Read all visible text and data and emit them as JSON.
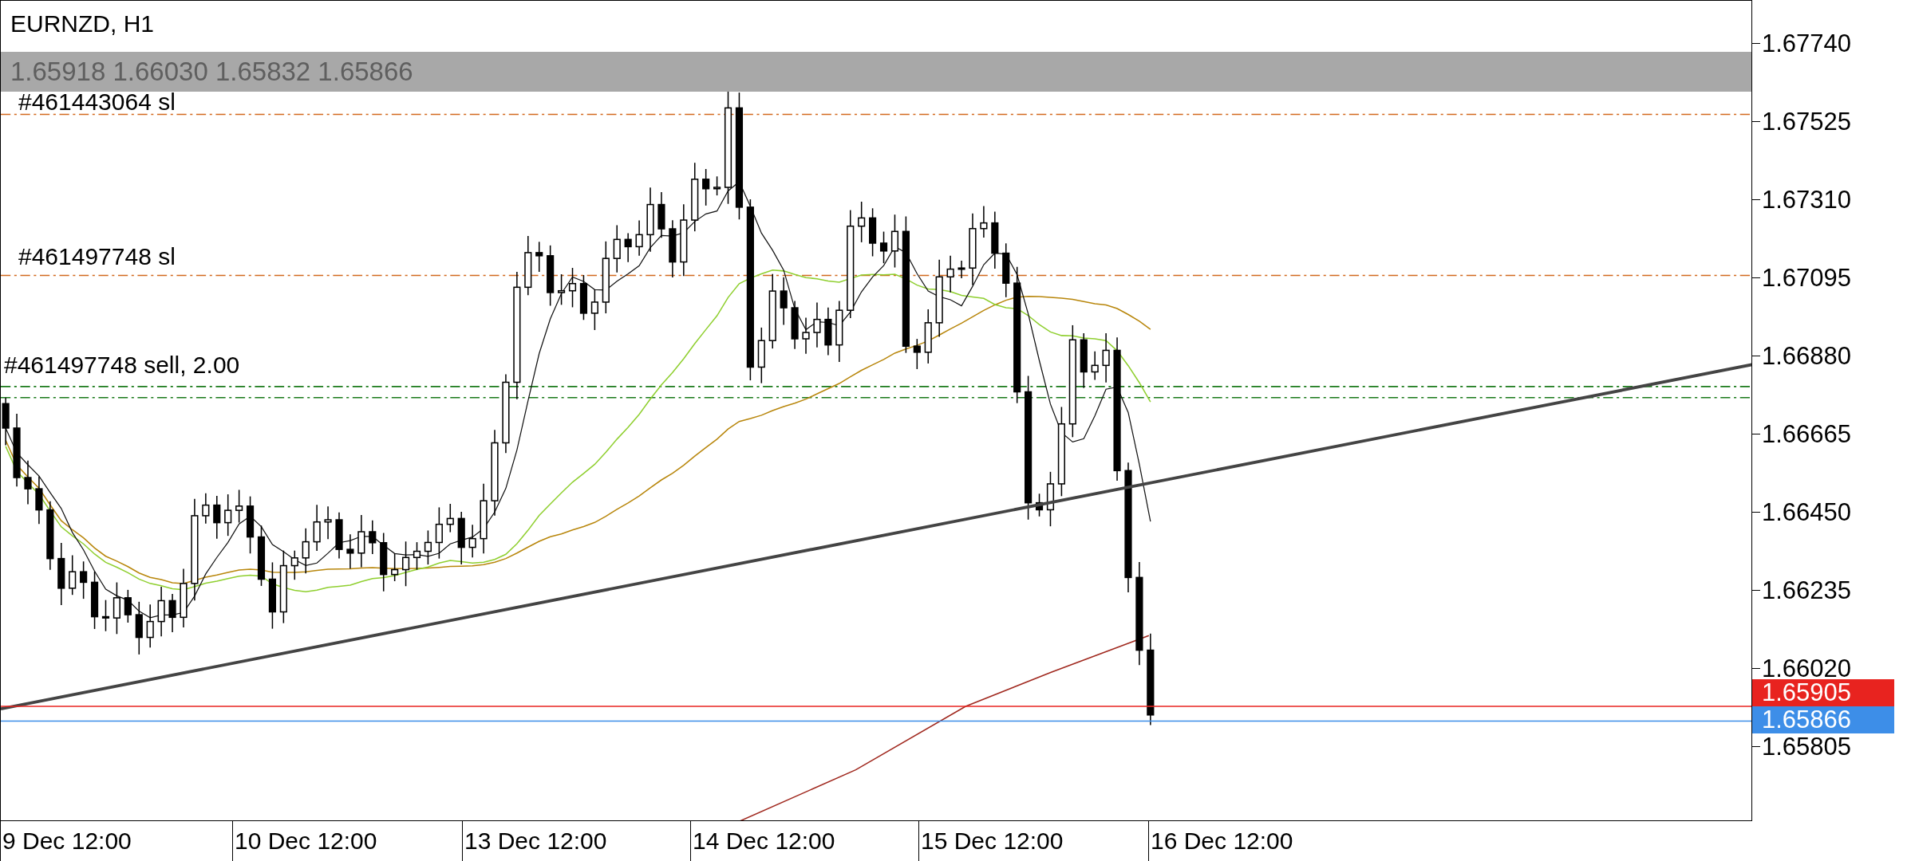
{
  "chart": {
    "symbol": "EURNZD, H1",
    "ohlc": "1.65918 1.66030 1.65832 1.65866",
    "order_labels": [
      "#461443064 sl",
      "#461497748 sl",
      "#461497748 sell, 2.00"
    ]
  },
  "price_axis": {
    "ticks": [
      "1.67740",
      "1.67525",
      "1.67310",
      "1.67095",
      "1.66880",
      "1.66665",
      "1.66450",
      "1.66235",
      "1.66020",
      "1.65805"
    ],
    "price_tags": [
      {
        "text": "1.65905",
        "color": "#e8231f"
      },
      {
        "text": "1.65866",
        "color": "#3d8ee8"
      }
    ]
  },
  "time_axis": {
    "labels": [
      "9 Dec 12:00",
      "10 Dec 12:00",
      "13 Dec 12:00",
      "14 Dec 12:00",
      "15 Dec 12:00",
      "16 Dec 12:00"
    ]
  }
}
